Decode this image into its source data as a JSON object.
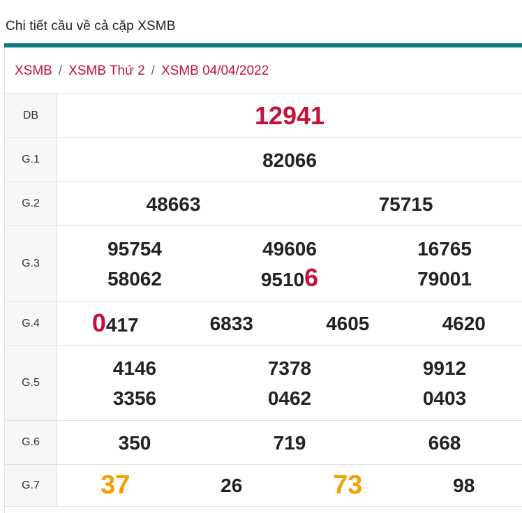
{
  "page": {
    "title": "Chi tiết cầu về cả cặp XSMB"
  },
  "breadcrumb": [
    "XSMB",
    "XSMB Thứ 2",
    "XSMB 04/04/2022"
  ],
  "colors": {
    "accent": "#0a7a7a",
    "red": "#c4103a",
    "orange": "#f5a000"
  },
  "results": {
    "db": {
      "label": "DB",
      "value": "12941"
    },
    "g1": {
      "label": "G.1",
      "values": [
        "82066"
      ]
    },
    "g2": {
      "label": "G.2",
      "values": [
        "48663",
        "75715"
      ]
    },
    "g3": {
      "label": "G.3",
      "row1": [
        "95754",
        "49606",
        "16765"
      ],
      "row2": [
        "58062",
        "9510",
        "6",
        "79001"
      ]
    },
    "g4": {
      "label": "G.4",
      "first_digit": "0",
      "first_rest": "417",
      "values": [
        "6833",
        "4605",
        "4620"
      ]
    },
    "g5": {
      "label": "G.5",
      "row1": [
        "4146",
        "7378",
        "9912"
      ],
      "row2": [
        "3356",
        "0462",
        "0403"
      ]
    },
    "g6": {
      "label": "G.6",
      "values": [
        "350",
        "719",
        "668"
      ]
    },
    "g7": {
      "label": "G.7",
      "values": [
        "37",
        "26",
        "73",
        "98"
      ]
    }
  }
}
